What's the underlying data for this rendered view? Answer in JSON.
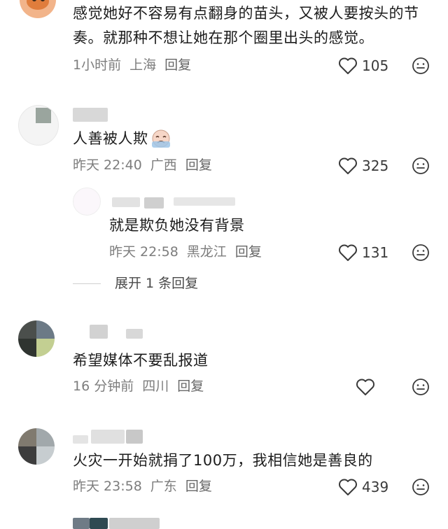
{
  "comments": [
    {
      "text": "感觉她好不容易有点翻身的苗头，又被人要按头的节奏。就那种不想让她在那个圈里出头的感觉。",
      "time": "1小时前",
      "location": "上海",
      "reply": "回复",
      "likes": "105"
    },
    {
      "text": "人善被人欺",
      "time": "昨天 22:40",
      "location": "广西",
      "reply": "回复",
      "likes": "325",
      "sub_reply": {
        "text": "就是欺负她没有背景",
        "time": "昨天 22:58",
        "location": "黑龙江",
        "reply": "回复",
        "likes": "131"
      },
      "expand": "展开 1 条回复"
    },
    {
      "text": "希望媒体不要乱报道",
      "time": "16 分钟前",
      "location": "四川",
      "reply": "回复",
      "likes": ""
    },
    {
      "text": "火灾一开始就捐了100万，我相信她是善良的",
      "time": "昨天 23:58",
      "location": "广东",
      "reply": "回复",
      "likes": "439"
    }
  ],
  "icons": {
    "like": "heart-outline-icon",
    "reaction": "emoji-face-icon",
    "emoji_inline": "crying-emoji-icon"
  },
  "colors": {
    "meta": "#7d7d7d",
    "text": "#1c1c1c"
  }
}
